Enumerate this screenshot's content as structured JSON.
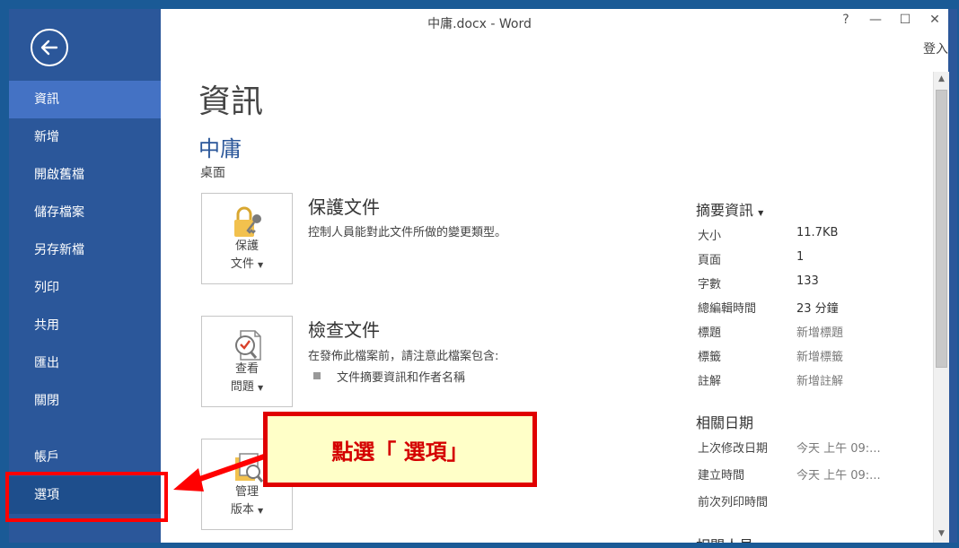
{
  "window": {
    "title": "中庸.docx - Word",
    "signin": "登入",
    "controls": {
      "help": "?",
      "minimize": "—",
      "maximize": "☐",
      "close": "✕"
    }
  },
  "sidebar": {
    "back_icon": "back-arrow-icon",
    "items": [
      {
        "label": "資訊"
      },
      {
        "label": "新增"
      },
      {
        "label": "開啟舊檔"
      },
      {
        "label": "儲存檔案"
      },
      {
        "label": "另存新檔"
      },
      {
        "label": "列印"
      },
      {
        "label": "共用"
      },
      {
        "label": "匯出"
      },
      {
        "label": "關閉"
      },
      {
        "label": "帳戶"
      },
      {
        "label": "選項"
      }
    ]
  },
  "main": {
    "page_title": "資訊",
    "doc_name": "中庸",
    "doc_location": "桌面",
    "sections": [
      {
        "button_line1": "保護",
        "button_line2": "文件",
        "title": "保護文件",
        "description": "控制人員能對此文件所做的變更類型。"
      },
      {
        "button_line1": "查看",
        "button_line2": "問題",
        "title": "檢查文件",
        "description": "在發佈此檔案前，請注意此檔案包含:",
        "bullet": "文件摘要資訊和作者名稱"
      },
      {
        "button_line1": "管理",
        "button_line2": "版本"
      }
    ]
  },
  "properties": {
    "heading": "摘要資訊",
    "rows": [
      {
        "label": "大小",
        "value": "11.7KB"
      },
      {
        "label": "頁面",
        "value": "1"
      },
      {
        "label": "字數",
        "value": "133"
      },
      {
        "label": "總編輯時間",
        "value": "23 分鐘"
      },
      {
        "label": "標題",
        "value": "新增標題"
      },
      {
        "label": "標籤",
        "value": "新增標籤"
      },
      {
        "label": "註解",
        "value": "新增註解"
      }
    ],
    "dates_heading": "相關日期",
    "dates": [
      {
        "label": "上次修改日期",
        "value": "今天 上午 09:..."
      },
      {
        "label": "建立時間",
        "value": "今天 上午 09:..."
      },
      {
        "label": "前次列印時間",
        "value": ""
      }
    ],
    "people_heading_partial": "相關人員"
  },
  "annotation": {
    "callout_text": "點選「 選項」"
  },
  "colors": {
    "sidebar": "#2b579a",
    "sidebar_active": "#4472c4",
    "accent_red": "#e00000",
    "callout_bg": "#ffffc8"
  }
}
